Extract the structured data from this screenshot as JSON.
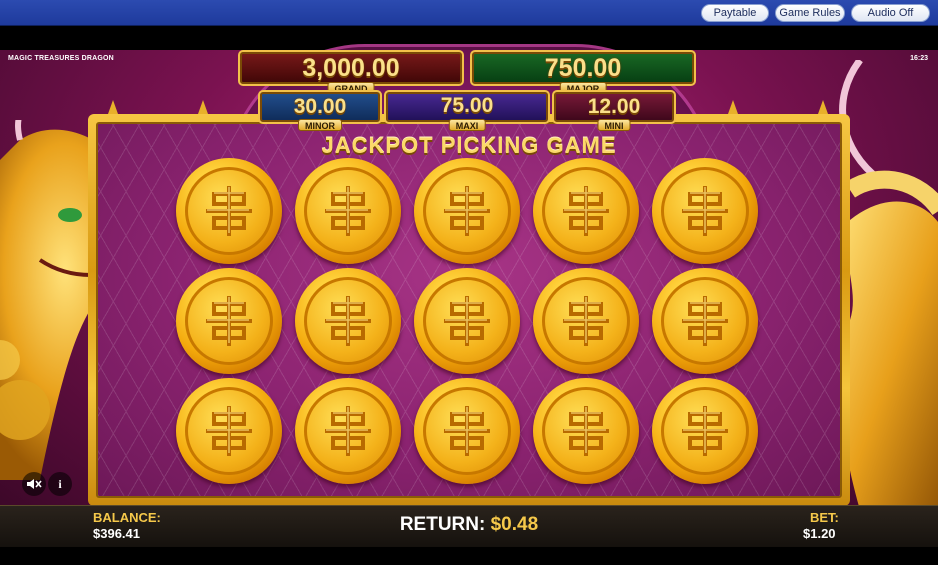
{
  "topbar": {
    "paytable_label": "Paytable",
    "game_rules_label": "Game Rules",
    "audio_label": "Audio Off"
  },
  "game": {
    "title": "MAGIC TREASURES DRAGON",
    "clock": "16:23",
    "heading": "JACKPOT PICKING GAME"
  },
  "jackpots": {
    "grand": {
      "value": "3,000.00",
      "label": "GRAND"
    },
    "major": {
      "value": "750.00",
      "label": "MAJOR"
    },
    "minor": {
      "value": "30.00",
      "label": "MINOR"
    },
    "maxi": {
      "value": "75.00",
      "label": "MAXI"
    },
    "mini": {
      "value": "12.00",
      "label": "MINI"
    }
  },
  "controls": {
    "mute_icon": "speaker-muted-icon",
    "info_icon": "info-icon",
    "info_glyph": "i"
  },
  "bottom": {
    "balance_label": "BALANCE:",
    "balance_value": "$396.41",
    "return_label": "RETURN:",
    "return_value": "$0.48",
    "bet_label": "BET:",
    "bet_value": "$1.20"
  },
  "colors": {
    "gold": "#f5c84a",
    "background": "#7a1250"
  }
}
